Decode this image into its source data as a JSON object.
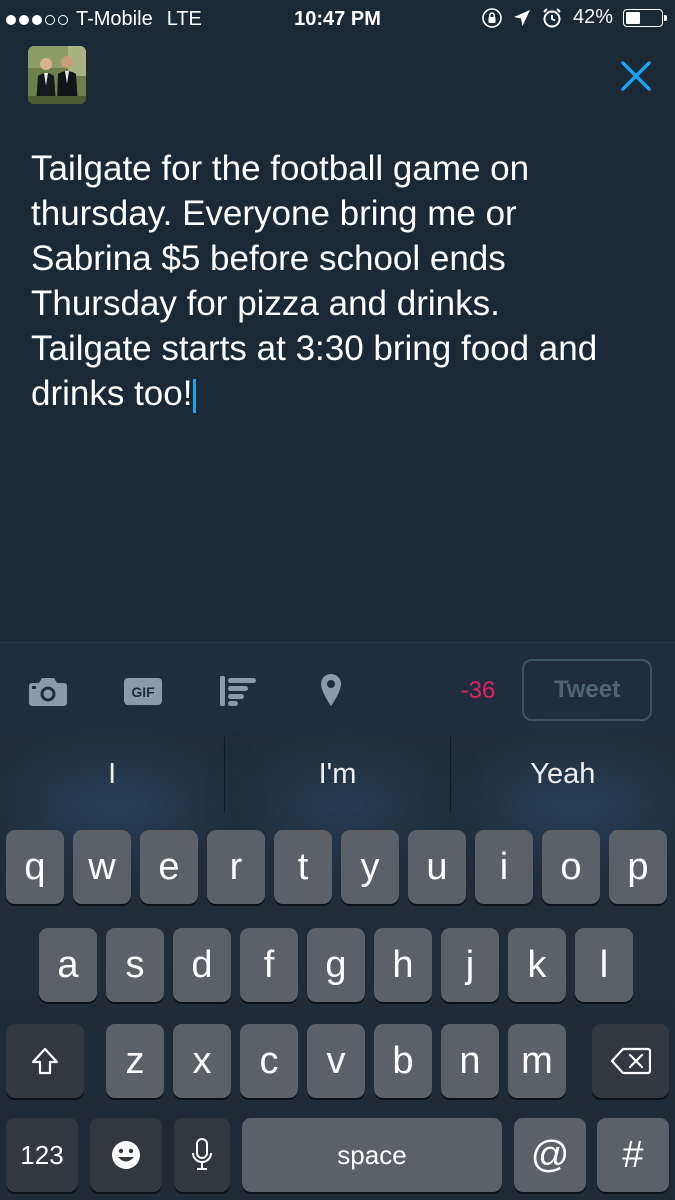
{
  "status_bar": {
    "carrier": "T-Mobile",
    "network": "LTE",
    "time": "10:47 PM",
    "battery_text": "42%",
    "battery_level": 0.42,
    "signal_bars": 3,
    "signal_total": 5,
    "icons": [
      "orientation-lock-icon",
      "location-arrow-icon",
      "alarm-icon",
      "battery-icon"
    ]
  },
  "compose": {
    "text": "Tailgate for the football game on\nthursday. Everyone bring me or\nSabrina $5 before school ends\nThursday for pizza and drinks.\nTailgate starts at 3:30 bring food and\ndrinks too!",
    "close_icon": "close-icon",
    "avatar_icon": "profile-photo"
  },
  "toolbar": {
    "icons": [
      "camera-icon",
      "gif-icon",
      "poll-icon",
      "location-pin-icon"
    ],
    "gif_label": "GIF",
    "char_count": "-36",
    "tweet_label": "Tweet"
  },
  "keyboard": {
    "suggestions": [
      "I",
      "I'm",
      "Yeah"
    ],
    "row1": [
      "q",
      "w",
      "e",
      "r",
      "t",
      "y",
      "u",
      "i",
      "o",
      "p"
    ],
    "row2": [
      "a",
      "s",
      "d",
      "f",
      "g",
      "h",
      "j",
      "k",
      "l"
    ],
    "row3": [
      "z",
      "x",
      "c",
      "v",
      "b",
      "n",
      "m"
    ],
    "numbers_label": "123",
    "space_label": "space",
    "at_label": "@",
    "hash_label": "#"
  },
  "colors": {
    "background": "#1b2836",
    "accent": "#1da1f2",
    "over_limit": "#e0245e"
  }
}
